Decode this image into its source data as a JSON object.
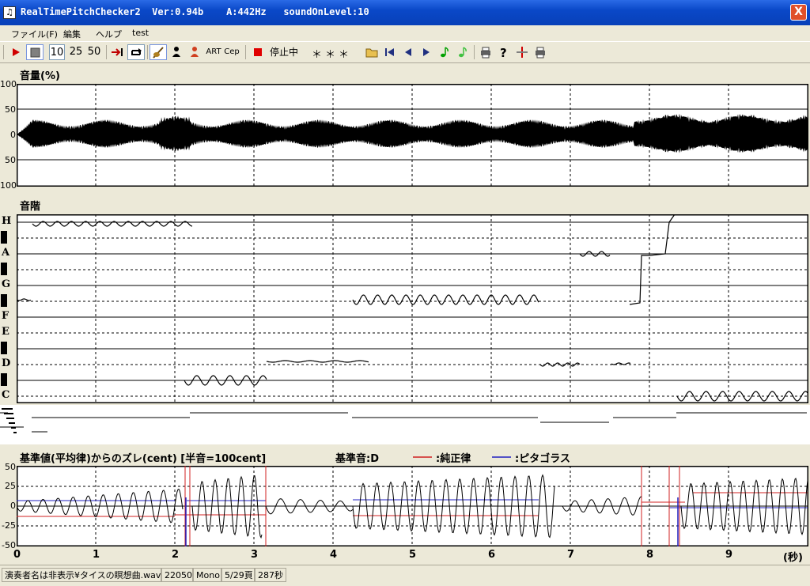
{
  "window": {
    "title": "RealTimePitchChecker2  Ver:0.94b    A:442Hz   soundOnLevel:10",
    "close_label": "X"
  },
  "menu": [
    "ファイル(F)",
    "編集",
    "ヘルプ",
    "test"
  ],
  "toolbar": {
    "speed_buttons": [
      "10",
      "25",
      "50"
    ],
    "text_buttons": [
      "ART",
      "Cep"
    ],
    "status": "停止中",
    "readout": "＊＊＊"
  },
  "volume": {
    "title": "音量(%)",
    "y_labels": [
      "100",
      "50",
      "0",
      "50",
      "100"
    ]
  },
  "scale": {
    "title": "音階",
    "notes": [
      "H",
      "A",
      "G",
      "F",
      "E",
      "D",
      "C"
    ]
  },
  "deviation": {
    "title": "基準値(平均律)からのズレ(cent) [半音=100cent]",
    "base_note": "基準音:D",
    "legend": [
      {
        "label": ":純正律",
        "color": "#D02020"
      },
      {
        "label": ":ピタゴラス",
        "color": "#2020C0"
      }
    ],
    "y_labels": [
      "50",
      "25",
      "0",
      "-25",
      "-50"
    ]
  },
  "time_axis": {
    "labels": [
      "0",
      "1",
      "2",
      "3",
      "4",
      "5",
      "6",
      "7",
      "8",
      "9"
    ],
    "unit": "(秒)"
  },
  "statusbar": [
    "演奏者名は非表示¥タイスの瞑想曲.wav",
    "22050",
    "Mono",
    "5/29頁",
    "287秒"
  ]
}
